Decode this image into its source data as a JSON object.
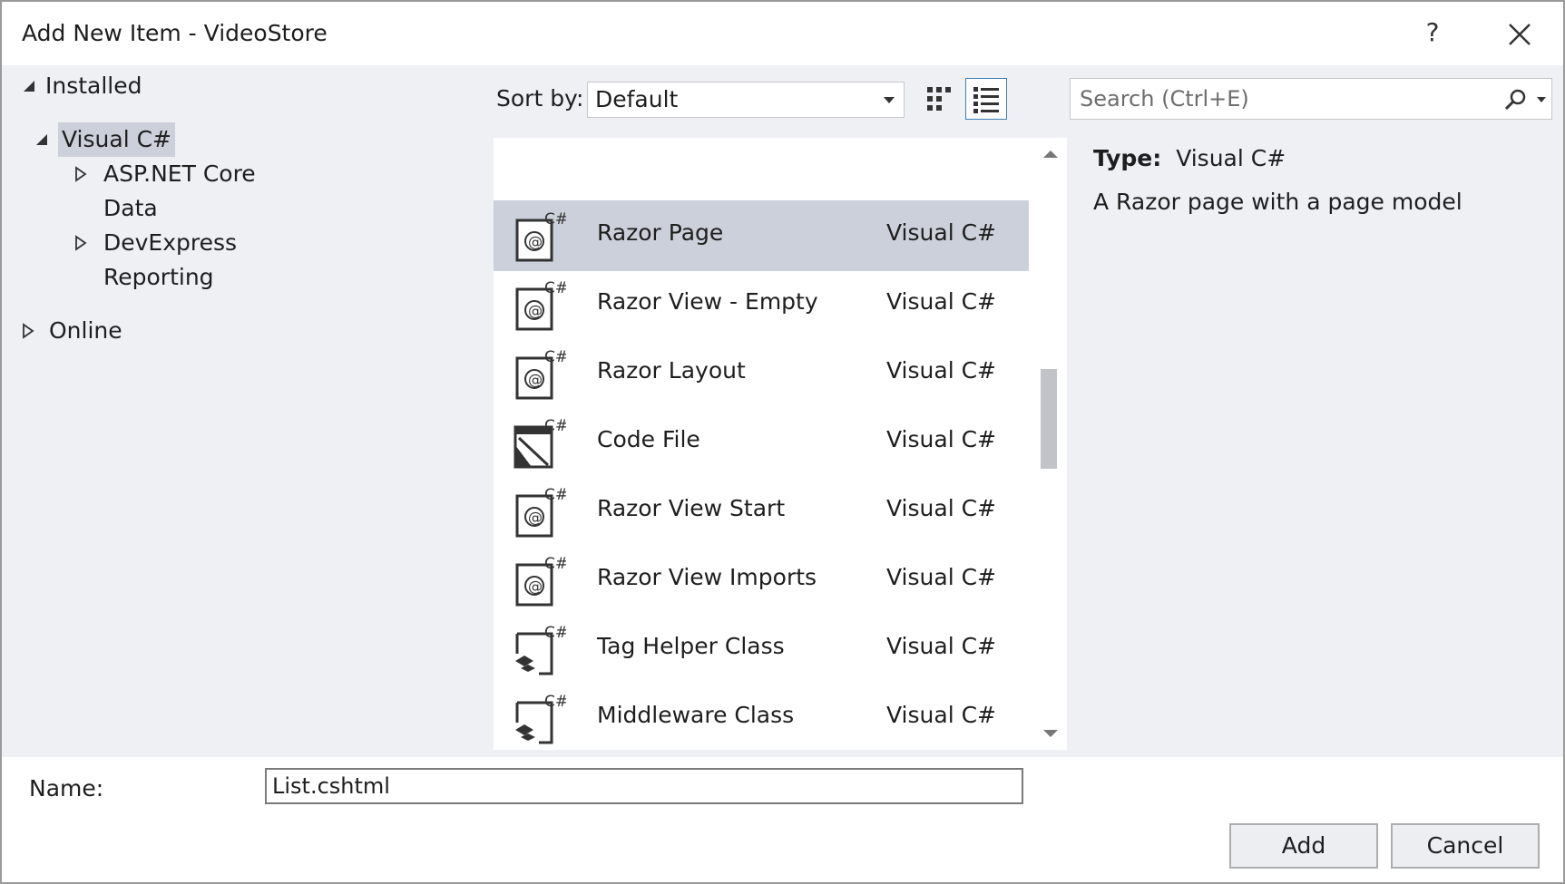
{
  "window": {
    "title": "Add New Item - VideoStore",
    "help_label": "?"
  },
  "tree": {
    "installed": "Installed",
    "visual_csharp": "Visual C#",
    "aspnet_core": "ASP.NET Core",
    "data": "Data",
    "devexpress": "DevExpress",
    "reporting": "Reporting",
    "online": "Online"
  },
  "sort": {
    "label": "Sort by:",
    "value": "Default"
  },
  "search": {
    "placeholder": "Search (Ctrl+E)"
  },
  "templates": [
    {
      "name": "Razor Page",
      "type": "Visual C#",
      "icon": "razor-icon",
      "selected": true
    },
    {
      "name": "Razor View - Empty",
      "type": "Visual C#",
      "icon": "razor-icon"
    },
    {
      "name": "Razor Layout",
      "type": "Visual C#",
      "icon": "razor-icon"
    },
    {
      "name": "Code File",
      "type": "Visual C#",
      "icon": "code-file-icon"
    },
    {
      "name": "Razor View Start",
      "type": "Visual C#",
      "icon": "razor-icon"
    },
    {
      "name": "Razor View Imports",
      "type": "Visual C#",
      "icon": "razor-icon"
    },
    {
      "name": "Tag Helper Class",
      "type": "Visual C#",
      "icon": "class-icon"
    },
    {
      "name": "Middleware Class",
      "type": "Visual C#",
      "icon": "class-icon"
    }
  ],
  "details": {
    "type_label": "Type:",
    "type_value": "Visual C#",
    "description": "A Razor page with a page model"
  },
  "footer": {
    "name_label": "Name:",
    "name_value": "List.cshtml",
    "add_label": "Add",
    "cancel_label": "Cancel"
  },
  "colors": {
    "selection": "#ccd0da",
    "panel": "#eef0f4",
    "accent": "#3c7fb1"
  }
}
